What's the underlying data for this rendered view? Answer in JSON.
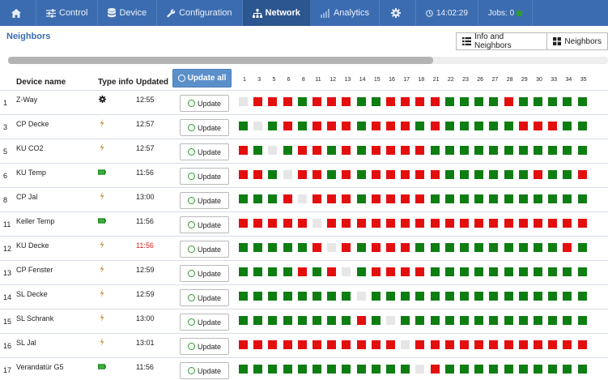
{
  "nav": {
    "items": [
      {
        "key": "home",
        "label": "",
        "icon": "home-icon"
      },
      {
        "key": "control",
        "label": "Control",
        "icon": "sliders-icon"
      },
      {
        "key": "device",
        "label": "Device",
        "icon": "database-icon"
      },
      {
        "key": "configuration",
        "label": "Configuration",
        "icon": "wrench-icon"
      },
      {
        "key": "network",
        "label": "Network",
        "icon": "network-icon",
        "active": true
      },
      {
        "key": "analytics",
        "label": "Analytics",
        "icon": "bar-chart-icon"
      },
      {
        "key": "settings",
        "label": "",
        "icon": "gear-icon"
      }
    ],
    "time": "14:02:29",
    "jobs": "Jobs: 0"
  },
  "page": {
    "title": "Neighbors",
    "view_info_label": "Info and Neighbors",
    "view_neighbors_label": "Neighbors"
  },
  "table": {
    "headers": {
      "device_name": "Device name",
      "type_info": "Type info",
      "updated": "Updated",
      "update_all": "Update all"
    },
    "update_label": "Update",
    "columns": [
      "1",
      "3",
      "5",
      "6",
      "8",
      "11",
      "12",
      "13",
      "14",
      "15",
      "16",
      "17",
      "18",
      "21",
      "22",
      "23",
      "26",
      "27",
      "28",
      "29",
      "30",
      "33",
      "34",
      "35"
    ],
    "rows": [
      {
        "id": "1",
        "name": "Z-Way",
        "type": "gear",
        "updated": "12:55",
        "stale": false,
        "cells": "srrrgrrrggrrrrggggrggggg"
      },
      {
        "id": "3",
        "name": "CP Decke",
        "type": "bolt",
        "updated": "12:57",
        "stale": false,
        "cells": "gsgrgrrrgrrrgrgggggrrrgg"
      },
      {
        "id": "5",
        "name": "KU CO2",
        "type": "bolt",
        "updated": "12:57",
        "stale": false,
        "cells": "rgsgrrgrgrrrrggggggggggg"
      },
      {
        "id": "6",
        "name": "KU Temp",
        "type": "battery",
        "updated": "11:56",
        "stale": false,
        "cells": "rrgsrrgrgrrrrrggggggrggr"
      },
      {
        "id": "8",
        "name": "CP Jal",
        "type": "bolt",
        "updated": "13:00",
        "stale": false,
        "cells": "gggrsrrrgrrrrggggggggggg"
      },
      {
        "id": "11",
        "name": "Keller Temp",
        "type": "battery",
        "updated": "11:56",
        "stale": false,
        "cells": "rrrrrsrrrrrrrrrrrrrrrrrr"
      },
      {
        "id": "12",
        "name": "KU Decke",
        "type": "bolt",
        "updated": "11:56",
        "stale": true,
        "cells": "gggggrsrgrrrggggggggggrg"
      },
      {
        "id": "13",
        "name": "CP Fenster",
        "type": "bolt",
        "updated": "12:59",
        "stale": false,
        "cells": "ggggrgrsgrrrrggggggggggg"
      },
      {
        "id": "14",
        "name": "SL Decke",
        "type": "bolt",
        "updated": "12:59",
        "stale": false,
        "cells": "ggggggggsggggggggggggggg"
      },
      {
        "id": "15",
        "name": "SL Schrank",
        "type": "bolt",
        "updated": "13:00",
        "stale": false,
        "cells": "ggggggggrgsggggggggggggg"
      },
      {
        "id": "16",
        "name": "SL Jal",
        "type": "bolt",
        "updated": "13:01",
        "stale": false,
        "cells": "rrrrrrrrrrrsrrrrrrrrrrrr"
      },
      {
        "id": "17",
        "name": "Verandatür G5",
        "type": "battery",
        "updated": "11:56",
        "stale": false,
        "cells": "ggggggggggggsrgggggggggg"
      }
    ]
  },
  "colors": {
    "navbar": "#3c6cb0",
    "navbar_active": "#2c568f",
    "neighbor_yes": "#0f7e12",
    "neighbor_no": "#e30f0f",
    "self": "#e6e6e6",
    "stale_text": "#d22222"
  }
}
